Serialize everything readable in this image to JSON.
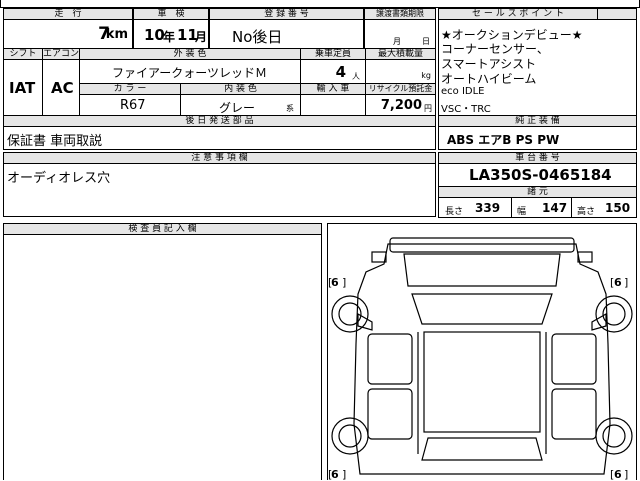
{
  "top": {
    "mileage_label": "走　行",
    "mileage_value": "7",
    "mileage_unit": "km",
    "shaken_label": "車　検",
    "shaken_year": "10",
    "shaken_year_unit": "年",
    "shaken_month": "11",
    "shaken_month_unit": "月",
    "reg_label": "登 録 番 号",
    "reg_value": "No後日",
    "transfer_label": "譲渡書類期限",
    "transfer_month_unit": "月",
    "transfer_day_unit": "日"
  },
  "spec": {
    "shift_label": "シフト",
    "shift_value": "IAT",
    "aircon_label": "エアコン",
    "aircon_value": "AC",
    "exterior_label": "外 装 色",
    "exterior_value": "ファイアークォーツレッドＭ",
    "capacity_label": "乗車定員",
    "capacity_value": "4",
    "capacity_unit": "人",
    "load_label": "最大積載量",
    "load_unit": "kg",
    "color_label": "カ ラ ー",
    "color_value": "R67",
    "interior_label": "内 装 色",
    "interior_value": "グレー",
    "interior_suffix": "系",
    "import_label": "輸 入 車",
    "recycle_label": "リサイクル預託金",
    "recycle_value": "7,200",
    "recycle_unit": "円"
  },
  "later": {
    "label": "後 日 発 送 部 品",
    "value": "保証書 車両取説"
  },
  "sales": {
    "label": "セ ー ル ス ポ イ ン ト",
    "lines": [
      "★オークションデビュー★",
      "コーナーセンサー、",
      "スマートアシスト",
      "オートハイビーム",
      "eco IDLE",
      "VSC・TRC"
    ]
  },
  "equipment": {
    "label": "純 正 装 備",
    "value": "ABS エアB PS PW"
  },
  "notes": {
    "label": "注 意 事 項 欄",
    "value": "オーディオレス穴"
  },
  "chassis": {
    "label": "車 台 番 号",
    "value": "LA350S-0465184"
  },
  "dims": {
    "label": "諸 元",
    "length_label": "長さ",
    "length_value": "339",
    "width_label": "幅",
    "width_value": "147",
    "height_label": "高さ",
    "height_value": "150"
  },
  "inspector": {
    "label": "検 査 員 記 入 欄"
  },
  "diagram": {
    "tire_marks": [
      "6",
      "6",
      "6",
      "6"
    ]
  }
}
